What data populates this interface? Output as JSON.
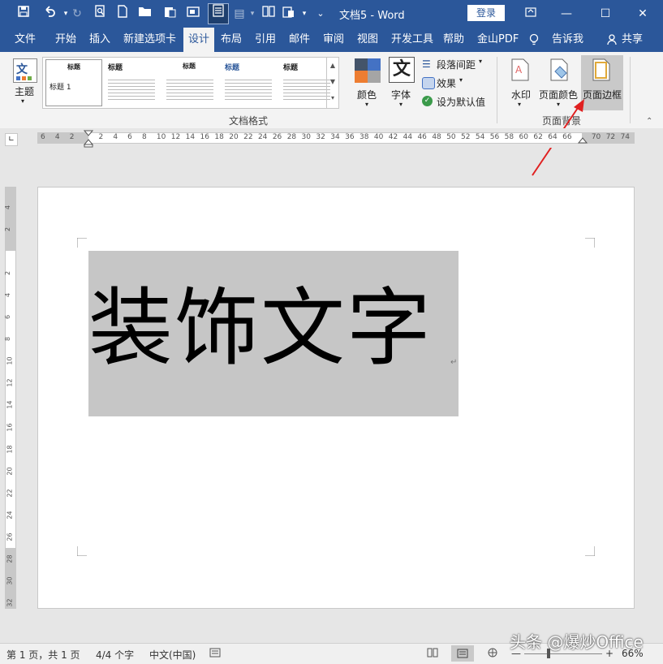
{
  "window": {
    "title": "文档5 - Word",
    "login": "登录",
    "buttons": {
      "restore": "⧉",
      "minimize": "—",
      "maximize": "☐",
      "close": "✕"
    }
  },
  "qat": {
    "save": "save-icon",
    "undo": "undo-icon",
    "redo": "redo-icon",
    "preview": "print-preview-icon",
    "new": "new-doc-icon",
    "open": "open-folder-icon"
  },
  "tabs": [
    {
      "label": "文件"
    },
    {
      "label": "开始"
    },
    {
      "label": "插入"
    },
    {
      "label": "新建选项卡"
    },
    {
      "label": "设计"
    },
    {
      "label": "布局"
    },
    {
      "label": "引用"
    },
    {
      "label": "邮件"
    },
    {
      "label": "审阅"
    },
    {
      "label": "视图"
    },
    {
      "label": "开发工具"
    },
    {
      "label": "帮助"
    },
    {
      "label": "金山PDF"
    }
  ],
  "tell_me": "告诉我",
  "share": "共享",
  "ribbon": {
    "theme_label": "主题",
    "gallery": {
      "first": {
        "title": "标题",
        "body": "标题 1"
      },
      "thumbs": [
        "标题",
        "标题",
        "标题",
        "标题"
      ]
    },
    "colors_label": "颜色",
    "fonts_label": "字体",
    "paragraph_spacing": "段落间距",
    "effects": "效果",
    "set_default": "设为默认值",
    "group_doc_format": "文档格式",
    "watermark": "水印",
    "page_color": "页面颜色",
    "page_borders": "页面边框",
    "group_page_background": "页面背景",
    "accent_color": "#2b579a",
    "selected_button_bg": "#c9c9c9"
  },
  "ruler": {
    "numbers": [
      "6",
      "4",
      "2",
      "",
      "2",
      "4",
      "6",
      "8",
      "10",
      "12",
      "14",
      "16",
      "18",
      "20",
      "22",
      "24",
      "26",
      "28",
      "30",
      "32",
      "34",
      "36",
      "38",
      "40",
      "42",
      "44",
      "46",
      "48",
      "50",
      "52",
      "54",
      "56",
      "58",
      "60",
      "62",
      "64",
      "66",
      "",
      "70",
      "72",
      "74"
    ],
    "vertical": [
      "4",
      "2",
      "",
      "2",
      "4",
      "6",
      "8",
      "10",
      "12",
      "14",
      "16",
      "18",
      "20",
      "22",
      "24",
      "26",
      "28",
      "30",
      "32"
    ]
  },
  "document": {
    "text": "装饰文字",
    "highlight_color": "#c6c6c6",
    "paragraph_mark": "↵"
  },
  "statusbar": {
    "page": "第 1 页，共 1 页",
    "words": "4/4 个字",
    "language": "中文(中国)",
    "zoom": "66%",
    "zoom_minus": "—",
    "zoom_plus": "+"
  },
  "watermark_text": "头条 @爆炒Office"
}
